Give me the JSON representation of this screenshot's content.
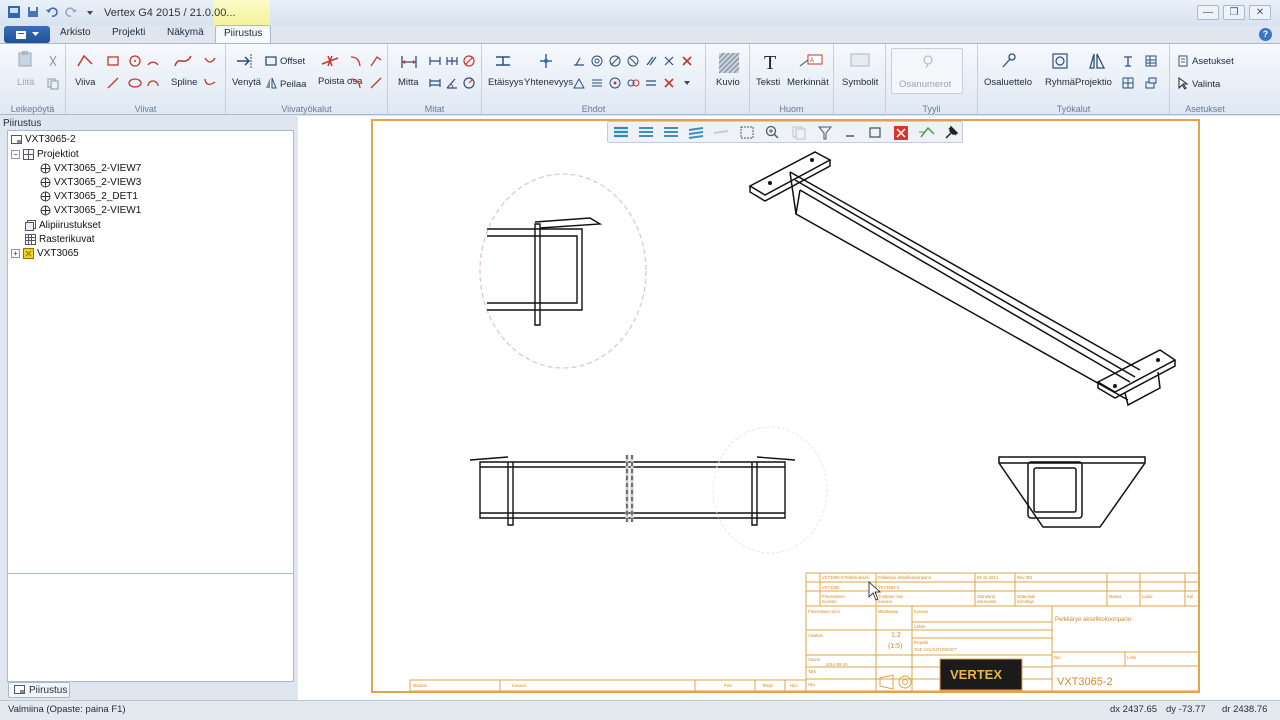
{
  "window": {
    "title": "Vertex G4 2015 / 21.0.00...",
    "controls": {
      "minimize": "—",
      "restore": "❐",
      "close": "✕"
    }
  },
  "tabs": [
    {
      "label": "Arkisto"
    },
    {
      "label": "Projekti"
    },
    {
      "label": "Näkymä"
    },
    {
      "label": "Piirustus"
    }
  ],
  "ribbon": {
    "groups": {
      "clipboard": "Leikepöytä",
      "lines": "Viivat",
      "line_tools": "Viivatyökalut",
      "dimensions": "Mitat",
      "constraints": "Ehdot",
      "note": "Huom",
      "style": "Tyyli",
      "tools": "Työkalut",
      "settings": "Asetukset"
    },
    "buttons": {
      "paste": "Liitä",
      "line": "Viiva",
      "spline": "Spline",
      "stretch": "Venytä",
      "offset": "Offset",
      "mirror": "Peilaa",
      "delete_part": "Poista osa",
      "dimension": "Mitta",
      "distance": "Etäisyys",
      "coincident": "Yhtenevyys",
      "pattern": "Kuvio",
      "text": "Teksti",
      "markings": "Merkinnät",
      "symbols": "Symbolit",
      "part_numbers": "Osanumerot",
      "part_list": "Osaluettelo",
      "group": "Ryhmä",
      "projection": "Projektio",
      "settings": "Asetukset",
      "selection": "Valinta"
    }
  },
  "panel": {
    "title": "Piirustus",
    "tree": [
      {
        "label": "VXT3065-2",
        "level": 0
      },
      {
        "label": "Projektiot",
        "level": 1
      },
      {
        "label": "VXT3065_2-VIEW7",
        "level": 2
      },
      {
        "label": "VXT3065_2-VIEW3",
        "level": 2
      },
      {
        "label": "VXT3065_2_DET1",
        "level": 2
      },
      {
        "label": "VXT3065_2-VIEW1",
        "level": 2
      },
      {
        "label": "Alipiirustukset",
        "level": 1
      },
      {
        "label": "Rasterikuvat",
        "level": 1
      },
      {
        "label": "VXT3065",
        "level": 1
      }
    ],
    "bottom_tab": "Piirustus"
  },
  "title_block": {
    "scale_top": "1:2",
    "scale_bottom": "(1:5)",
    "description": "Pelkkärye akselikokoonpano",
    "logo_text": "VERTEX",
    "drawing_number": "VXT3065-2"
  },
  "status": {
    "hint": "Valmiina (Opaste: paina F1)",
    "dx": "dx 2437.65",
    "dy": "dy -73.77",
    "dr": "dr 2438.76"
  },
  "colors": {
    "sheet_border": "#e2a34a",
    "ribbon_bg": "#eaf0f7",
    "active_tab_highlight": "#f3f39a"
  }
}
